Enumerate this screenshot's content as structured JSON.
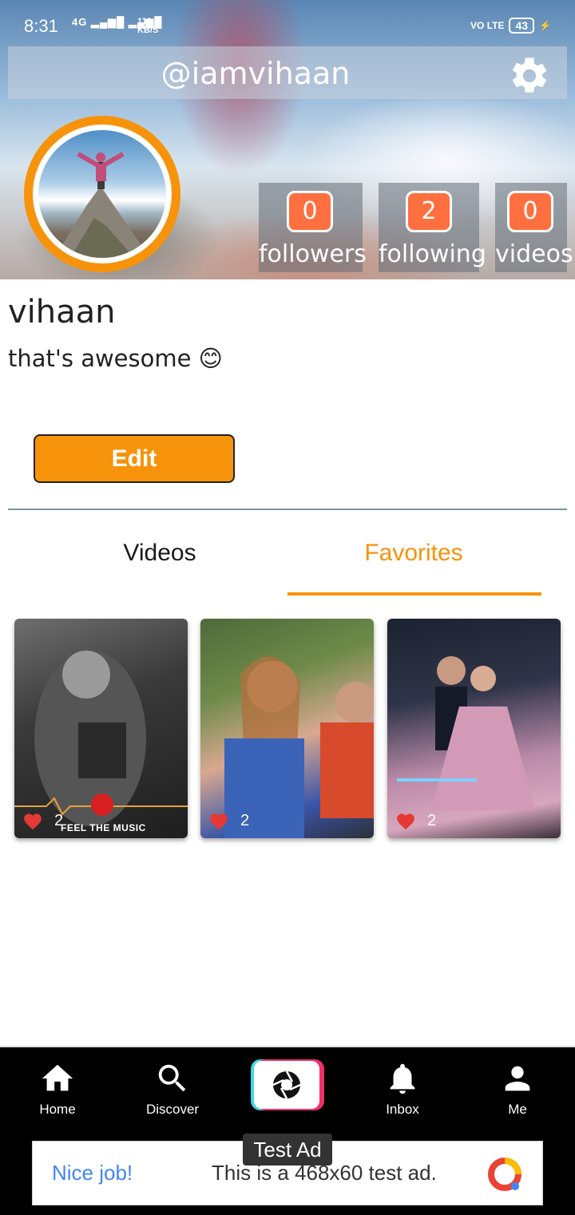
{
  "status_bar": {
    "time": "8:31",
    "network": "4G",
    "speed_top": "119",
    "speed_bottom": "KB/S",
    "volte": "VO LTE",
    "battery": "43"
  },
  "header": {
    "username": "@iamvihaan",
    "settings_icon": "gear-icon"
  },
  "stats": [
    {
      "value": "0",
      "label": "followers"
    },
    {
      "value": "2",
      "label": "following"
    },
    {
      "value": "0",
      "label": "videos"
    }
  ],
  "profile": {
    "name": "vihaan",
    "bio": "that's awesome 😊",
    "edit_label": "Edit"
  },
  "tabs": {
    "videos": "Videos",
    "favorites": "Favorites",
    "active": "favorites"
  },
  "thumbnails": [
    {
      "likes": "2",
      "caption": "FEEL THE MUSIC"
    },
    {
      "likes": "2",
      "caption": ""
    },
    {
      "likes": "2",
      "caption": ""
    }
  ],
  "nav": {
    "home": "Home",
    "discover": "Discover",
    "inbox": "Inbox",
    "me": "Me"
  },
  "ad": {
    "label": "Test Ad",
    "title": "Nice job!",
    "text": "This is a 468x60 test ad."
  },
  "colors": {
    "accent": "#f7930a",
    "stat_badge": "#ff6f40",
    "like_heart": "#e53935"
  }
}
